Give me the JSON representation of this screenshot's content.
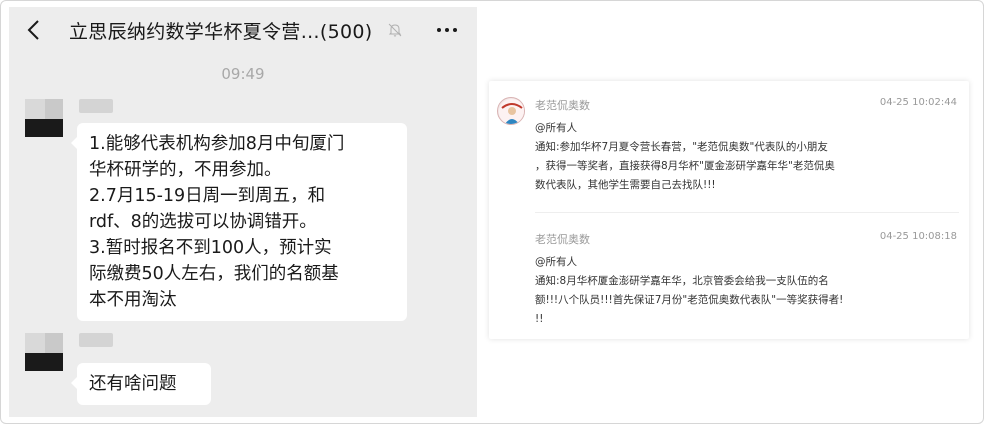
{
  "chat": {
    "title": "立思辰纳约数学华杯夏令营…(500)",
    "time": "09:49",
    "message1_lines": [
      "1.能够代表机构参加8月中旬厦门",
      "华杯研学的，不用参加。",
      "2.7月15-19日周一到周五，和",
      "rdf、8的选拔可以协调错开。",
      "3.暂时报名不到100人，预计实",
      "际缴费50人左右，我们的名额基",
      "本不用淘汰"
    ],
    "message2": "还有啥问题"
  },
  "notice": {
    "posts": [
      {
        "name": "老范侃奥数",
        "date": "04-25 10:02:44",
        "lines": [
          "@所有人",
          "通知:参加华杯7月夏令营长春营，\"老范侃奥数\"代表队的小朋友",
          "，获得一等奖者，直接获得8月华杯\"厦金澎研学嘉年华\"老范侃奥",
          "数代表队，其他学生需要自己去找队!!!"
        ]
      },
      {
        "name": "老范侃奥数",
        "date": "04-25 10:08:18",
        "lines": [
          "@所有人",
          "通知:8月华杯厦金澎研学嘉年华，北京管委会给我一支队伍的名",
          "额!!!八个队员!!!首先保证7月份\"老范侃奥数代表队\"一等奖获得者!",
          "!!"
        ]
      }
    ]
  },
  "icons": [
    "back-icon",
    "mute-icon",
    "more-icon"
  ],
  "colors": {
    "chat_bg": "#ededed",
    "bubble": "#ffffff",
    "meta_gray": "#999999"
  }
}
